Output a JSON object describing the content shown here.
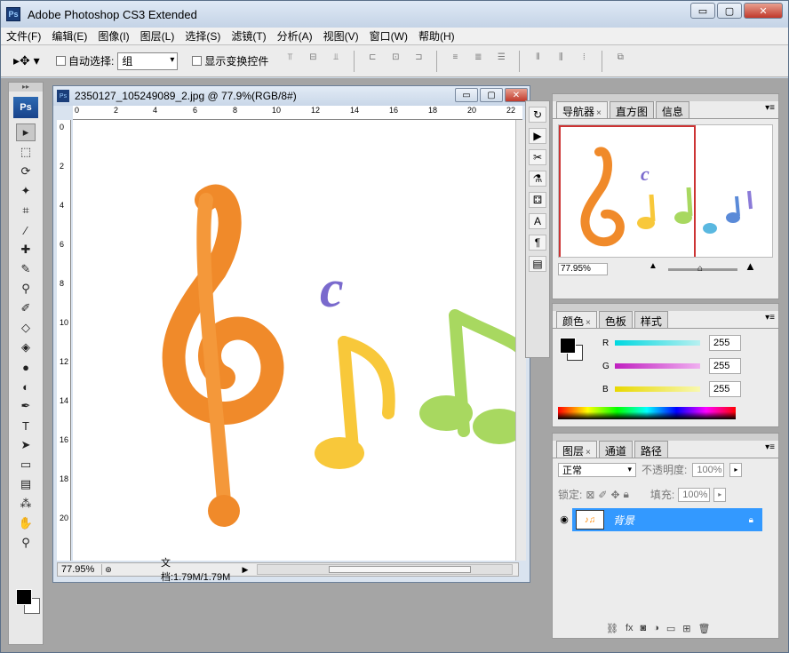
{
  "app": {
    "title": "Adobe Photoshop CS3 Extended",
    "logo": "Ps"
  },
  "window_buttons": {
    "minimize": "▭",
    "maximize": "▢",
    "close": "✕"
  },
  "menu": [
    "文件(F)",
    "编辑(E)",
    "图像(I)",
    "图层(L)",
    "选择(S)",
    "滤镜(T)",
    "分析(A)",
    "视图(V)",
    "窗口(W)",
    "帮助(H)"
  ],
  "options": {
    "auto_select_label": "自动选择:",
    "auto_select_value": "组",
    "show_transform_label": "显示变换控件"
  },
  "document": {
    "title": "2350127_105249089_2.jpg @ 77.9%(RGB/8#)",
    "zoom": "77.95%",
    "doc_info": "文档:1.79M/1.79M",
    "ruler_h": [
      "0",
      "2",
      "4",
      "6",
      "8",
      "10",
      "12",
      "14",
      "16",
      "18",
      "20",
      "22"
    ],
    "ruler_v": [
      "0",
      "2",
      "4",
      "6",
      "8",
      "10",
      "12",
      "14",
      "16",
      "18",
      "20"
    ]
  },
  "navigator": {
    "tabs": [
      "导航器",
      "直方图",
      "信息"
    ],
    "zoom": "77.95%"
  },
  "color_panel": {
    "tabs": [
      "颜色",
      "色板",
      "样式"
    ],
    "channels": [
      {
        "label": "R",
        "value": "255",
        "color": "#00c8d8"
      },
      {
        "label": "G",
        "value": "255",
        "color": "#d030c8"
      },
      {
        "label": "B",
        "value": "255",
        "color": "#e8e020"
      }
    ]
  },
  "layers_panel": {
    "tabs": [
      "图层",
      "通道",
      "路径"
    ],
    "blend_mode": "正常",
    "opacity_label": "不透明度:",
    "opacity_value": "100%",
    "lock_label": "锁定:",
    "fill_label": "填充:",
    "fill_value": "100%",
    "layer_name": "背景"
  },
  "colors": {
    "accent": "#3399ff",
    "ps_blue": "#1a3e7a"
  }
}
